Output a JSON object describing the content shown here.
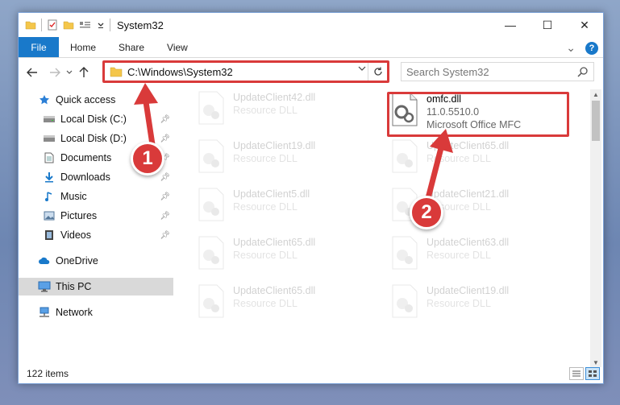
{
  "window": {
    "title": "System32",
    "minimize_glyph": "—",
    "maximize_glyph": "☐",
    "close_glyph": "✕"
  },
  "ribbon": {
    "tabs": [
      {
        "label": "File"
      },
      {
        "label": "Home"
      },
      {
        "label": "Share"
      },
      {
        "label": "View"
      }
    ],
    "expand_glyph": "⌄",
    "help_glyph": "?"
  },
  "address": {
    "path": "C:\\Windows\\System32",
    "search_placeholder": "Search System32"
  },
  "nav": {
    "items": [
      {
        "label": "Quick access",
        "icon": "star-icon",
        "pinned": false
      },
      {
        "label": "Local Disk (C:)",
        "icon": "drive-icon",
        "pinned": true
      },
      {
        "label": "Local Disk (D:)",
        "icon": "drive-icon",
        "pinned": true
      },
      {
        "label": "Documents",
        "icon": "documents-icon",
        "pinned": true
      },
      {
        "label": "Downloads",
        "icon": "downloads-icon",
        "pinned": true
      },
      {
        "label": "Music",
        "icon": "music-icon",
        "pinned": true
      },
      {
        "label": "Pictures",
        "icon": "pictures-icon",
        "pinned": true
      },
      {
        "label": "Videos",
        "icon": "videos-icon",
        "pinned": true
      },
      {
        "label": "OneDrive",
        "icon": "cloud-icon",
        "pinned": false
      },
      {
        "label": "This PC",
        "icon": "computer-icon",
        "pinned": false,
        "selected": true
      },
      {
        "label": "Network",
        "icon": "network-icon",
        "pinned": false
      }
    ]
  },
  "files": [
    {
      "name": "UpdateClient42.dll",
      "desc": "Resource DLL",
      "faded": true
    },
    {
      "name": "omfc.dll",
      "desc": "11.0.5510.0",
      "desc2": "Microsoft Office MFC",
      "faded": false
    },
    {
      "name": "UpdateClient19.dll",
      "desc": "Resource DLL",
      "faded": true
    },
    {
      "name": "UpdateClient65.dll",
      "desc": "Resource DLL",
      "faded": true
    },
    {
      "name": "UpdateClient5.dll",
      "desc": "Resource DLL",
      "faded": true
    },
    {
      "name": "UpdateClient21.dll",
      "desc": "Resource DLL",
      "faded": true
    },
    {
      "name": "UpdateClient65.dll",
      "desc": "Resource DLL",
      "faded": true
    },
    {
      "name": "UpdateClient63.dll",
      "desc": "Resource DLL",
      "faded": true
    },
    {
      "name": "UpdateClient65.dll",
      "desc": "Resource DLL",
      "faded": true
    },
    {
      "name": "UpdateClient19.dll",
      "desc": "Resource DLL",
      "faded": true
    }
  ],
  "status": {
    "item_count": "122 items"
  },
  "annotations": {
    "callout1": "1",
    "callout2": "2",
    "color": "#d93a3a"
  }
}
